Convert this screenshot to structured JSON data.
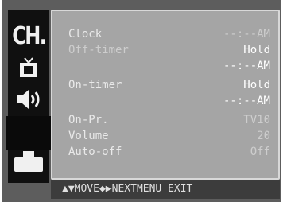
{
  "sidebar": {
    "items": [
      {
        "name": "channel",
        "label": "CH."
      },
      {
        "name": "picture",
        "icon": "tv-icon"
      },
      {
        "name": "sound",
        "icon": "speaker-icon"
      },
      {
        "name": "features",
        "icon": "blank-icon"
      },
      {
        "name": "setup",
        "icon": "box-icon"
      }
    ]
  },
  "menu": {
    "rows": [
      {
        "label": "Clock",
        "value": "--:--AM"
      },
      {
        "label": "Off-timer",
        "value": "Hold"
      },
      {
        "label": "",
        "value": "--:--AM"
      },
      {
        "label": "On-timer",
        "value": "Hold"
      },
      {
        "label": "",
        "value": "--:--AM"
      },
      {
        "label": "On-Pr.",
        "value": "TV10"
      },
      {
        "label": "Volume",
        "value": "20"
      },
      {
        "label": "Auto-off",
        "value": "Off"
      }
    ]
  },
  "footer": {
    "move": "▲▼MOVE",
    "next": "◆▶NEXT",
    "menu_exit": "MENU EXIT"
  },
  "colors": {
    "background": "#5d5d5d",
    "panel": "#a5a5a5",
    "sidebar": "#101010",
    "text": "#e9e9e9"
  }
}
